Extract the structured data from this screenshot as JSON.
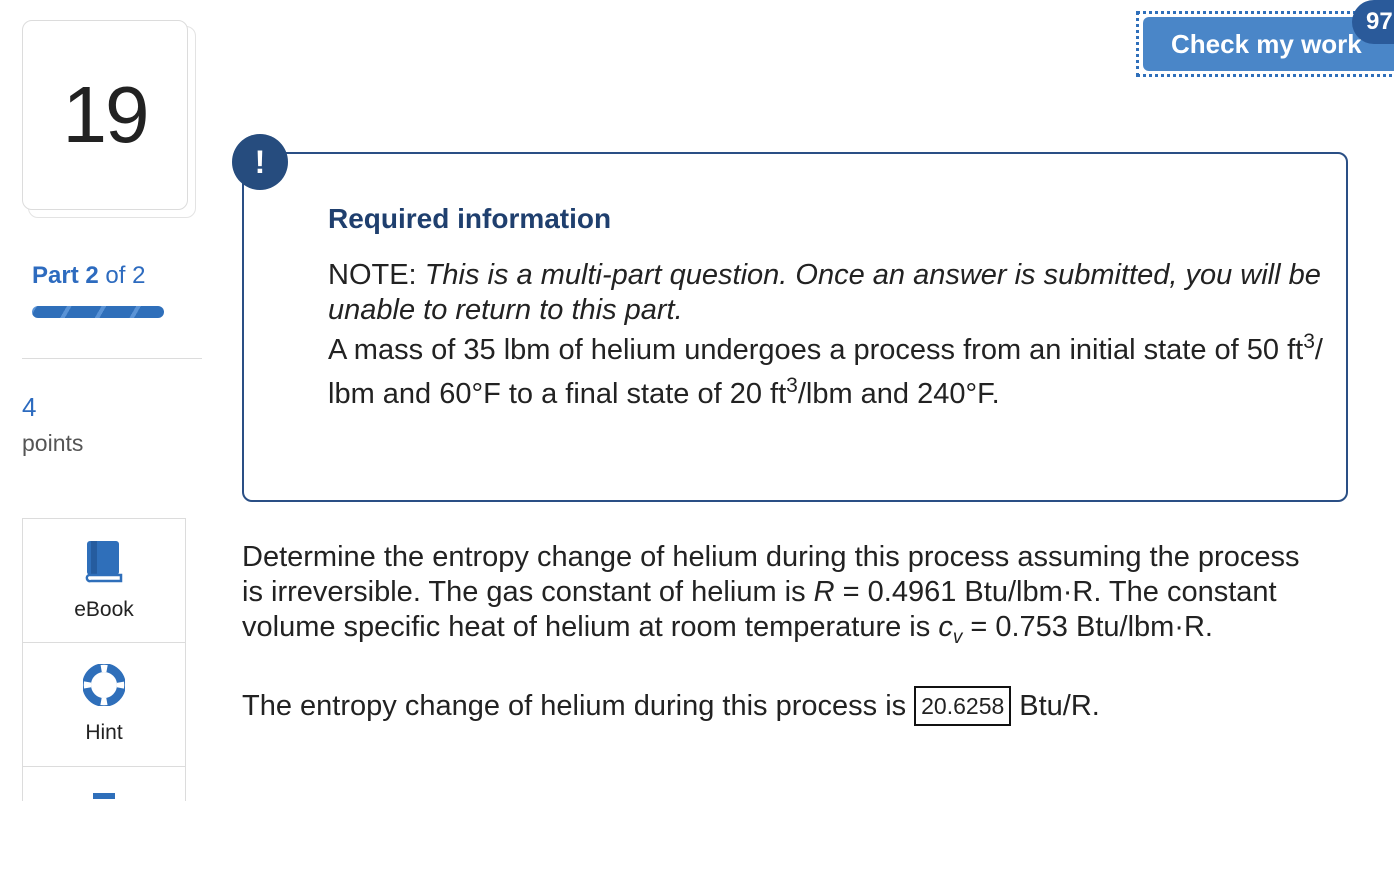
{
  "question": {
    "number": "19"
  },
  "part": {
    "label": "Part",
    "current": "2",
    "of_total": "of 2",
    "progress_fraction": 1.0
  },
  "points": {
    "value": "4",
    "label": "points"
  },
  "tools": [
    {
      "label": "eBook",
      "icon": "book-icon"
    },
    {
      "label": "Hint",
      "icon": "lifebuoy-icon"
    }
  ],
  "header": {
    "check_button": "Check my work",
    "badge": "97"
  },
  "info": {
    "alert_symbol": "!",
    "title": "Required information",
    "note_prefix": "NOTE:",
    "note_text": "This is a multi-part question. Once an answer is submitted, you will be unable to return to this part.",
    "given_1": "A mass of 35 lbm of helium undergoes a process from an initial state of 50 ft",
    "sup_1": "3",
    "given_2": "/ lbm and 60°F to a final state of 20 ft",
    "sup_2": "3",
    "given_3": "/lbm and 240°F."
  },
  "prompt": {
    "line1": "Determine the entropy change of helium during this process assuming the process",
    "line2_a": "is irreversible. The gas constant of helium is ",
    "line2_var": "R",
    "line2_b": " = 0.4961 Btu/lbm·R. The constant",
    "line3_a": "volume specific heat of helium at room temperature is ",
    "line3_var": "c",
    "line3_sub": "v",
    "line3_b": " = 0.753 Btu/lbm·R."
  },
  "answer": {
    "prefix": "The entropy change of helium during this process is",
    "value": "20.6258",
    "unit": "Btu/R."
  },
  "colors": {
    "accent": "#2d6bbf",
    "button": "#4a86c8",
    "info_border": "#2a4f85"
  }
}
